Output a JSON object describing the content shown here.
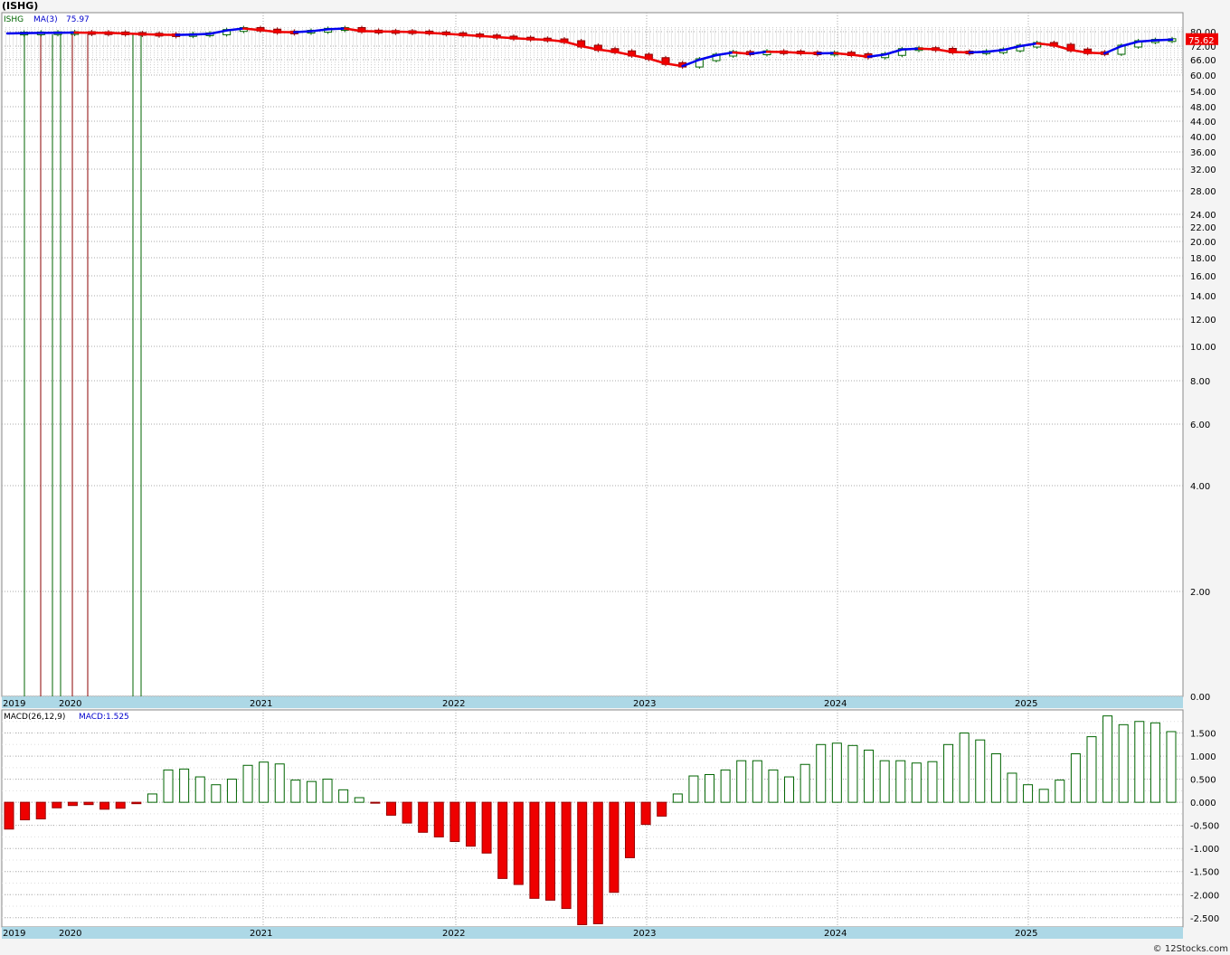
{
  "header": {
    "title": "(ISHG)"
  },
  "footer": {
    "credit": "© 12Stocks.com"
  },
  "price_panel": {
    "legend_symbol": "ISHG",
    "legend_ma": "MA(3)",
    "legend_ma_value": "75.97",
    "last_price_badge": "75.62"
  },
  "macd_panel": {
    "legend_name": "MACD(26,12,9)",
    "legend_value": "MACD:1.525"
  },
  "colors": {
    "ma_up": "#0000ee",
    "ma_down": "#ee0000",
    "macd_pos_stroke": "#006400",
    "macd_neg_fill": "#ee0000",
    "badge_bg": "#ee0000",
    "grid": "#aaaaaa",
    "axis_band": "#add8e6"
  },
  "chart_data": [
    {
      "type": "line",
      "scale": "log",
      "ylim": [
        0,
        82
      ],
      "yticks": [
        "80.00",
        "72.00",
        "66.00",
        "60.00",
        "54.00",
        "48.00",
        "44.00",
        "40.00",
        "36.00",
        "32.00",
        "28.00",
        "24.00",
        "22.00",
        "20.00",
        "18.00",
        "16.00",
        "14.00",
        "12.00",
        "10.00",
        "8.00",
        "6.00",
        "4.00",
        "2.00",
        "0.00"
      ],
      "xtick_labels": [
        "2019",
        "2020",
        "2021",
        "2022",
        "2023",
        "2024",
        "2025"
      ],
      "months": [
        "2019-12",
        "2020-01",
        "2020-02",
        "2020-03",
        "2020-04",
        "2020-05",
        "2020-06",
        "2020-07",
        "2020-08",
        "2020-09",
        "2020-10",
        "2020-11",
        "2020-12",
        "2021-01",
        "2021-02",
        "2021-03",
        "2021-04",
        "2021-05",
        "2021-06",
        "2021-07",
        "2021-08",
        "2021-09",
        "2021-10",
        "2021-11",
        "2021-12",
        "2022-01",
        "2022-02",
        "2022-03",
        "2022-04",
        "2022-05",
        "2022-06",
        "2022-07",
        "2022-08",
        "2022-09",
        "2022-10",
        "2022-11",
        "2022-12",
        "2023-01",
        "2023-02",
        "2023-03",
        "2023-04",
        "2023-05",
        "2023-06",
        "2023-07",
        "2023-08",
        "2023-09",
        "2023-10",
        "2023-11",
        "2023-12",
        "2024-01",
        "2024-02",
        "2024-03",
        "2024-04",
        "2024-05",
        "2024-06",
        "2024-07",
        "2024-08",
        "2024-09",
        "2024-10",
        "2024-11",
        "2024-12",
        "2025-01",
        "2025-02",
        "2025-03",
        "2025-04",
        "2025-05",
        "2025-06",
        "2025-07",
        "2025-08",
        "2025-09"
      ],
      "series": [
        {
          "values": [
            79.0,
            79.2,
            79.3,
            79.4,
            79.5,
            79.4,
            79.3,
            79.0,
            78.6,
            78.3,
            78.2,
            78.4,
            78.8,
            80.6,
            81.6,
            80.8,
            79.8,
            79.7,
            80.2,
            81.2,
            81.6,
            80.3,
            80.1,
            80.0,
            79.8,
            79.3,
            78.8,
            78.2,
            77.6,
            77.0,
            76.4,
            75.9,
            75.5,
            74.5,
            72.0,
            70.5,
            69.5,
            68.0,
            66.5,
            64.5,
            63.5,
            66.0,
            68.0,
            69.2,
            68.6,
            69.5,
            69.4,
            69.0,
            68.8,
            68.9,
            68.2,
            67.3,
            68.3,
            70.5,
            70.9,
            70.6,
            69.4,
            69.2,
            69.5,
            70.3,
            72.0,
            73.5,
            72.5,
            70.3,
            69.1,
            68.8,
            72.0,
            74.5,
            75.2,
            75.6
          ]
        }
      ]
    },
    {
      "type": "bar",
      "ylim": [
        -2.7,
        2.0
      ],
      "yticks": [
        "1.500",
        "1.000",
        "0.500",
        "0.000",
        "-0.500",
        "-1.000",
        "-1.500",
        "-2.000",
        "-2.500"
      ],
      "xtick_labels": [
        "2019",
        "2020",
        "2021",
        "2022",
        "2023",
        "2024",
        "2025"
      ],
      "values": [
        -0.58,
        -0.38,
        -0.36,
        -0.12,
        -0.07,
        -0.05,
        -0.15,
        -0.13,
        -0.03,
        0.18,
        0.7,
        0.72,
        0.55,
        0.38,
        0.5,
        0.8,
        0.87,
        0.83,
        0.48,
        0.45,
        0.5,
        0.27,
        0.1,
        -0.02,
        -0.28,
        -0.45,
        -0.65,
        -0.75,
        -0.85,
        -0.95,
        -1.1,
        -1.65,
        -1.78,
        -2.08,
        -2.12,
        -2.3,
        -2.65,
        -2.63,
        -1.95,
        -1.2,
        -0.48,
        -0.3,
        0.18,
        0.57,
        0.6,
        0.7,
        0.9,
        0.9,
        0.7,
        0.55,
        0.82,
        1.25,
        1.28,
        1.23,
        1.13,
        0.9,
        0.9,
        0.85,
        0.88,
        1.25,
        1.5,
        1.35,
        1.05,
        0.63,
        0.38,
        0.28,
        0.48,
        1.05,
        1.42,
        1.87,
        1.68,
        1.75,
        1.72,
        1.53
      ]
    }
  ]
}
